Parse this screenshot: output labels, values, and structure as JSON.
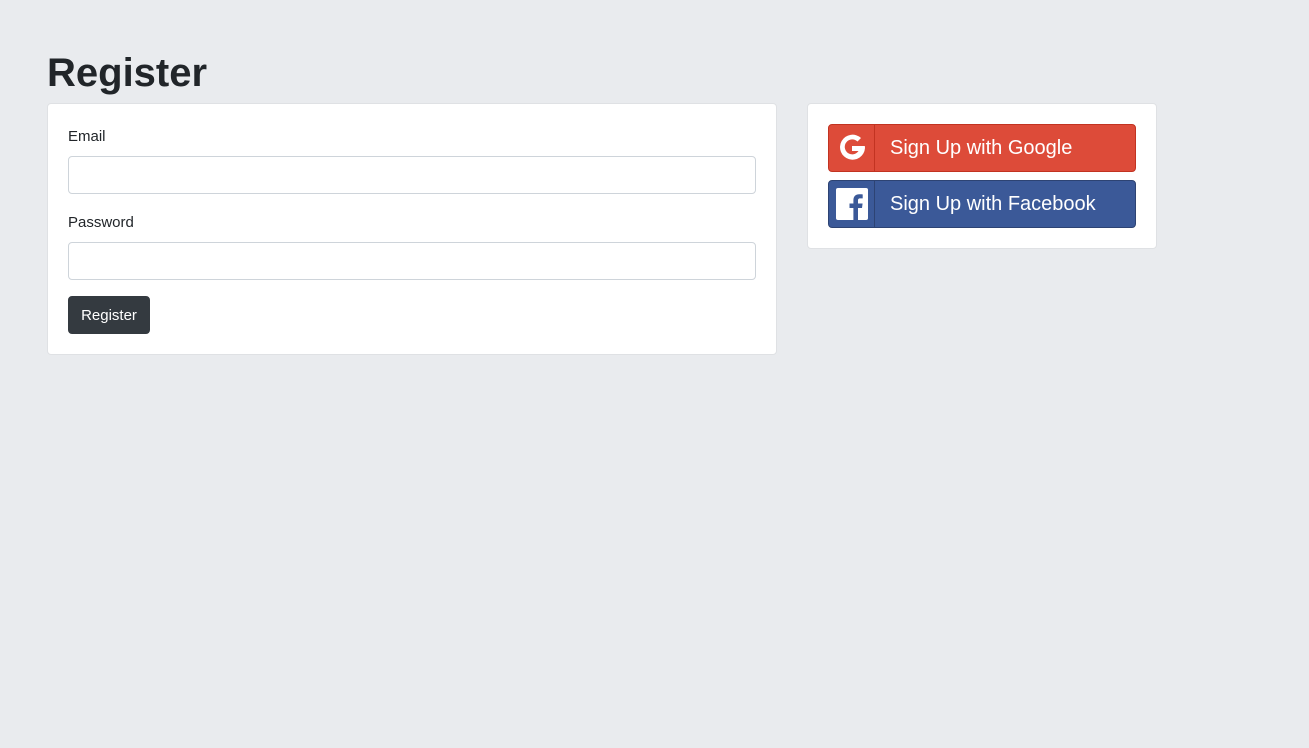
{
  "page": {
    "title": "Register"
  },
  "form": {
    "email_label": "Email",
    "email_value": "",
    "email_placeholder": "",
    "password_label": "Password",
    "password_value": "",
    "password_placeholder": "",
    "register_button_label": "Register"
  },
  "social": {
    "google": {
      "label": "Sign Up with Google",
      "icon": "google-icon",
      "color": "#dd4b39"
    },
    "facebook": {
      "label": "Sign Up with Facebook",
      "icon": "facebook-icon",
      "color": "#3b5998"
    }
  },
  "colors": {
    "background": "#e9ebee",
    "primary_button": "#343a40"
  }
}
